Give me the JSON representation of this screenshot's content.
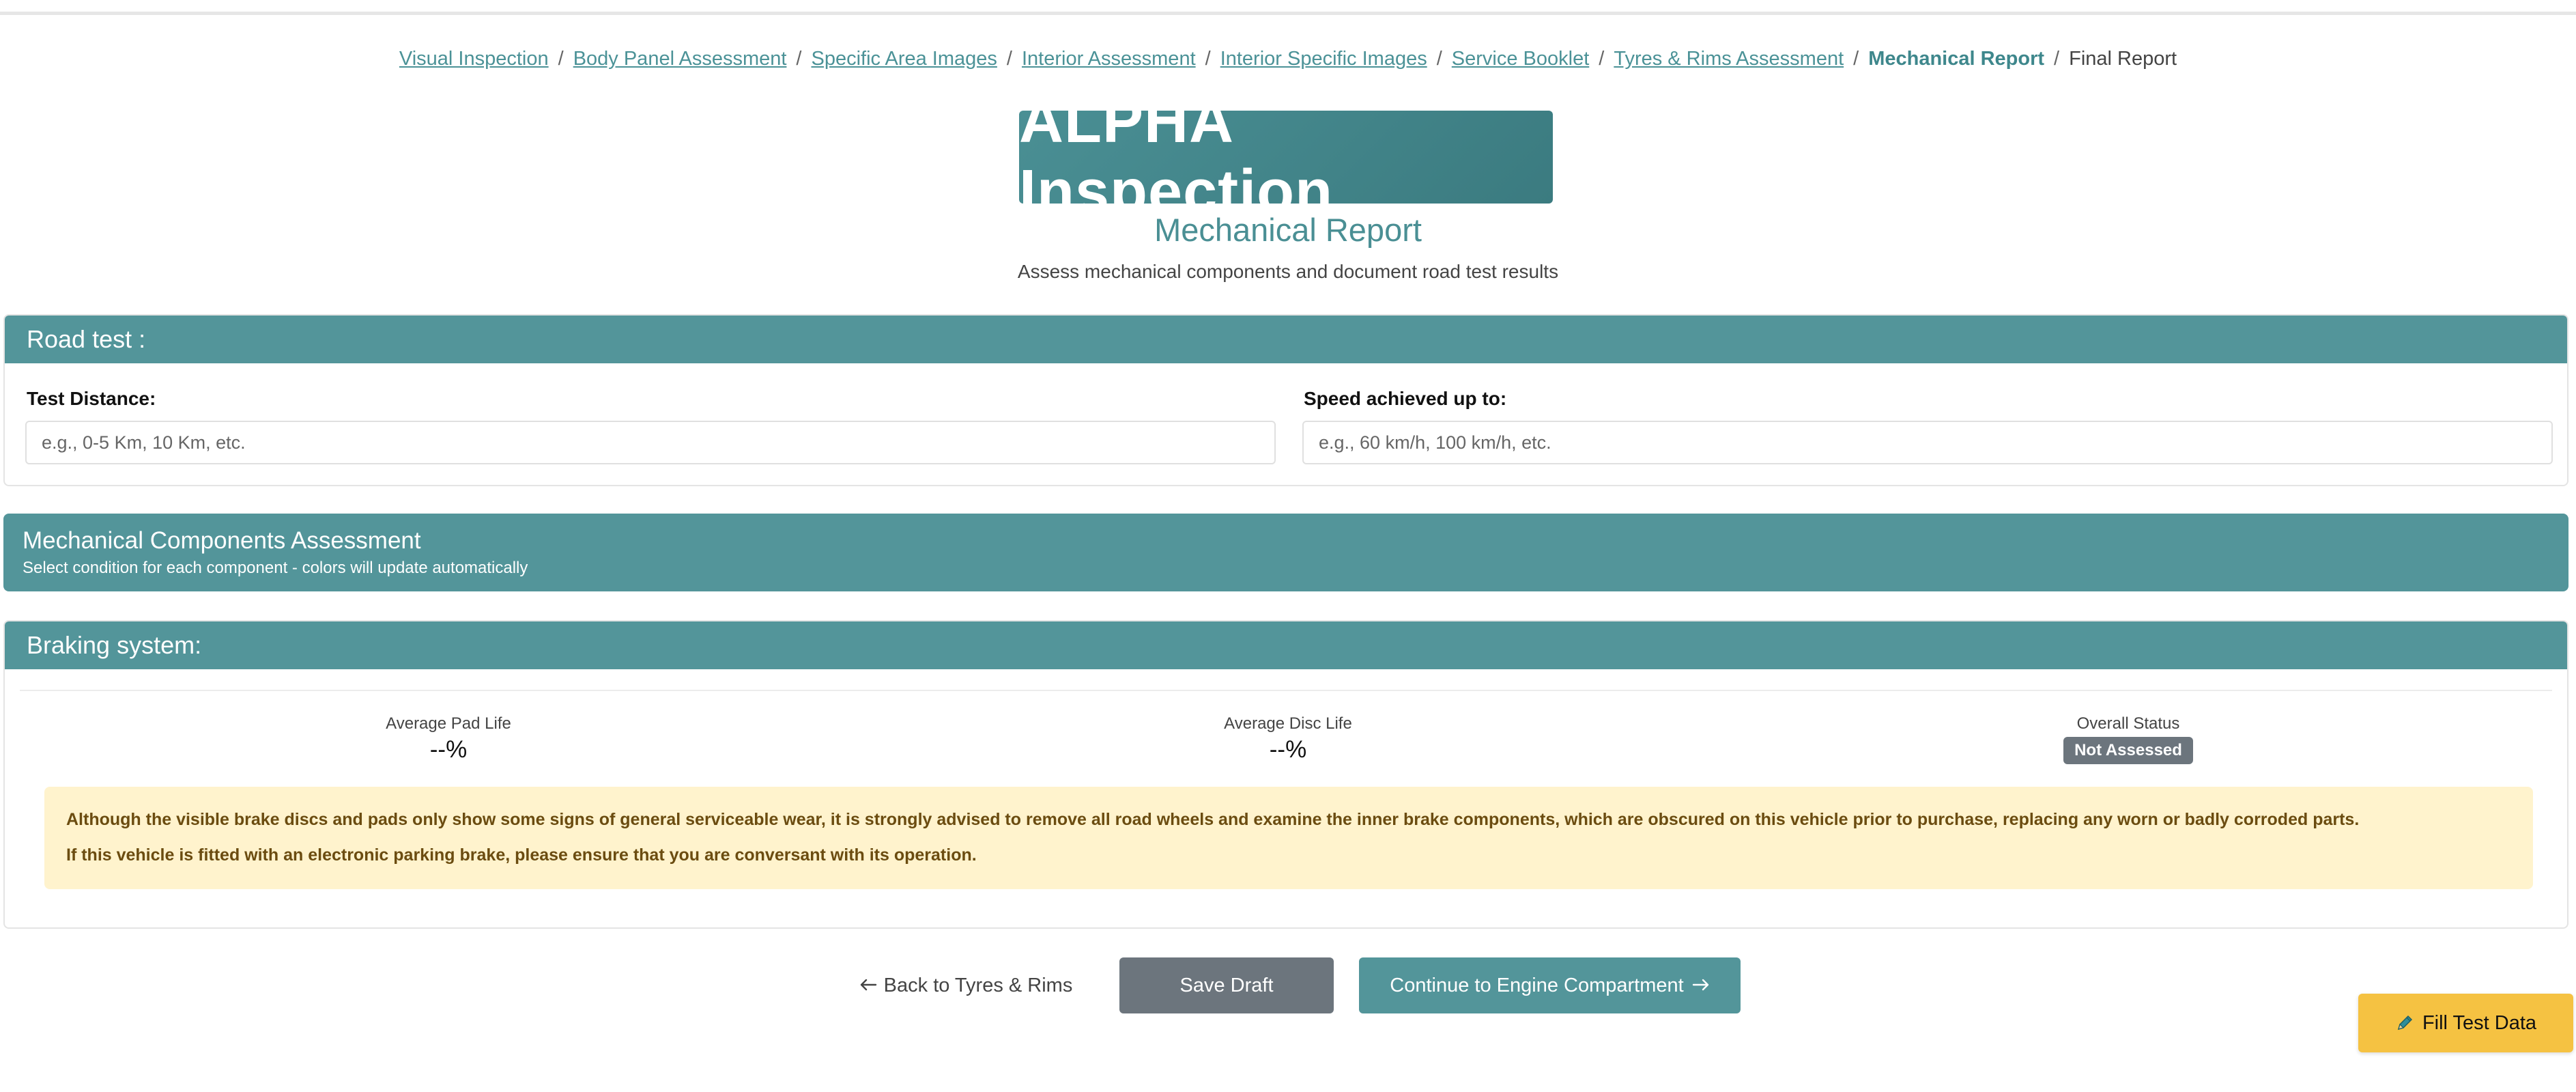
{
  "breadcrumb": {
    "items": [
      {
        "label": "Visual Inspection"
      },
      {
        "label": "Body Panel Assessment"
      },
      {
        "label": "Specific Area Images"
      },
      {
        "label": "Interior Assessment"
      },
      {
        "label": "Interior Specific Images"
      },
      {
        "label": "Service Booklet"
      },
      {
        "label": "Tyres & Rims Assessment"
      },
      {
        "label": "Mechanical Report"
      },
      {
        "label": "Final Report"
      }
    ],
    "separator": "/"
  },
  "header": {
    "brand": "ALPHA Inspection",
    "subtitle": "Mechanical Report",
    "description": "Assess mechanical components and document road test results"
  },
  "road_test": {
    "title": "Road test :",
    "distance_label": "Test Distance:",
    "distance_placeholder": "e.g., 0-5 Km, 10 Km, etc.",
    "distance_value": "",
    "speed_label": "Speed achieved up to:",
    "speed_placeholder": "e.g., 60 km/h, 100 km/h, etc.",
    "speed_value": ""
  },
  "mechanical": {
    "title": "Mechanical Components Assessment",
    "subtitle": "Select condition for each component - colors will update automatically"
  },
  "braking": {
    "title": "Braking system:",
    "pad_label": "Average Pad Life",
    "pad_value": "--%",
    "disc_label": "Average Disc Life",
    "disc_value": "--%",
    "status_label": "Overall Status",
    "status_value": "Not Assessed",
    "alert_line1": "Although the visible brake discs and pads only show some signs of general serviceable wear, it is strongly advised to remove all road wheels and examine the inner brake components, which are obscured on this vehicle prior to purchase, replacing any worn or badly corroded parts.",
    "alert_line2": "If this vehicle is fitted with an electronic parking brake, please ensure that you are conversant with its operation."
  },
  "footer": {
    "back_label": "Back to Tyres & Rims",
    "draft_label": "Save Draft",
    "continue_label": "Continue to Engine Compartment",
    "fill_label": "Fill Test Data"
  },
  "colors": {
    "teal": "#53959a",
    "teal_dark": "#3b7b80",
    "grey_button": "#6c757d",
    "alert_bg": "#fff3cd",
    "alert_text": "#6b4c10",
    "fill_button": "#f5c242"
  },
  "icons": {
    "back": "arrow-left-icon",
    "continue": "arrow-right-icon",
    "fill": "pencil-icon"
  }
}
